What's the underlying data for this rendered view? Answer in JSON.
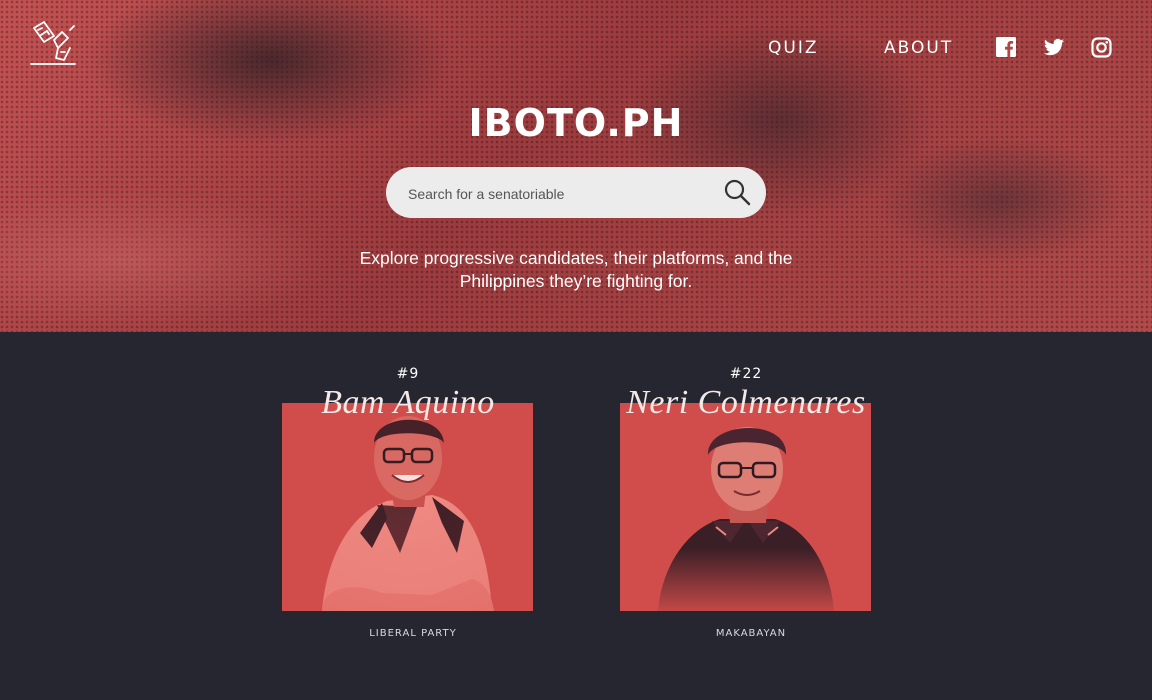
{
  "header": {
    "logo_icon": "ballot-box-hand-icon",
    "nav": [
      {
        "label": "QUIZ"
      },
      {
        "label": "ABOUT"
      }
    ],
    "social": [
      {
        "icon": "facebook-icon"
      },
      {
        "icon": "twitter-icon"
      },
      {
        "icon": "instagram-icon"
      }
    ]
  },
  "hero": {
    "title": "IBOTO.PH",
    "search": {
      "placeholder": "Search for a senatoriable",
      "value": "",
      "icon": "search-icon"
    },
    "tagline": "Explore progressive candidates, their platforms, and the Philippines they’re fighting for."
  },
  "candidates": [
    {
      "number": "#9",
      "name": "Bam Aquino",
      "party": "LIBERAL PARTY"
    },
    {
      "number": "#22",
      "name": "Neri Colmenares",
      "party": "MAKABAYAN"
    }
  ],
  "colors": {
    "hero_red": "#b04646",
    "background_dark": "#262631",
    "photo_red": "#d14d4b",
    "search_bg": "#ececec"
  }
}
